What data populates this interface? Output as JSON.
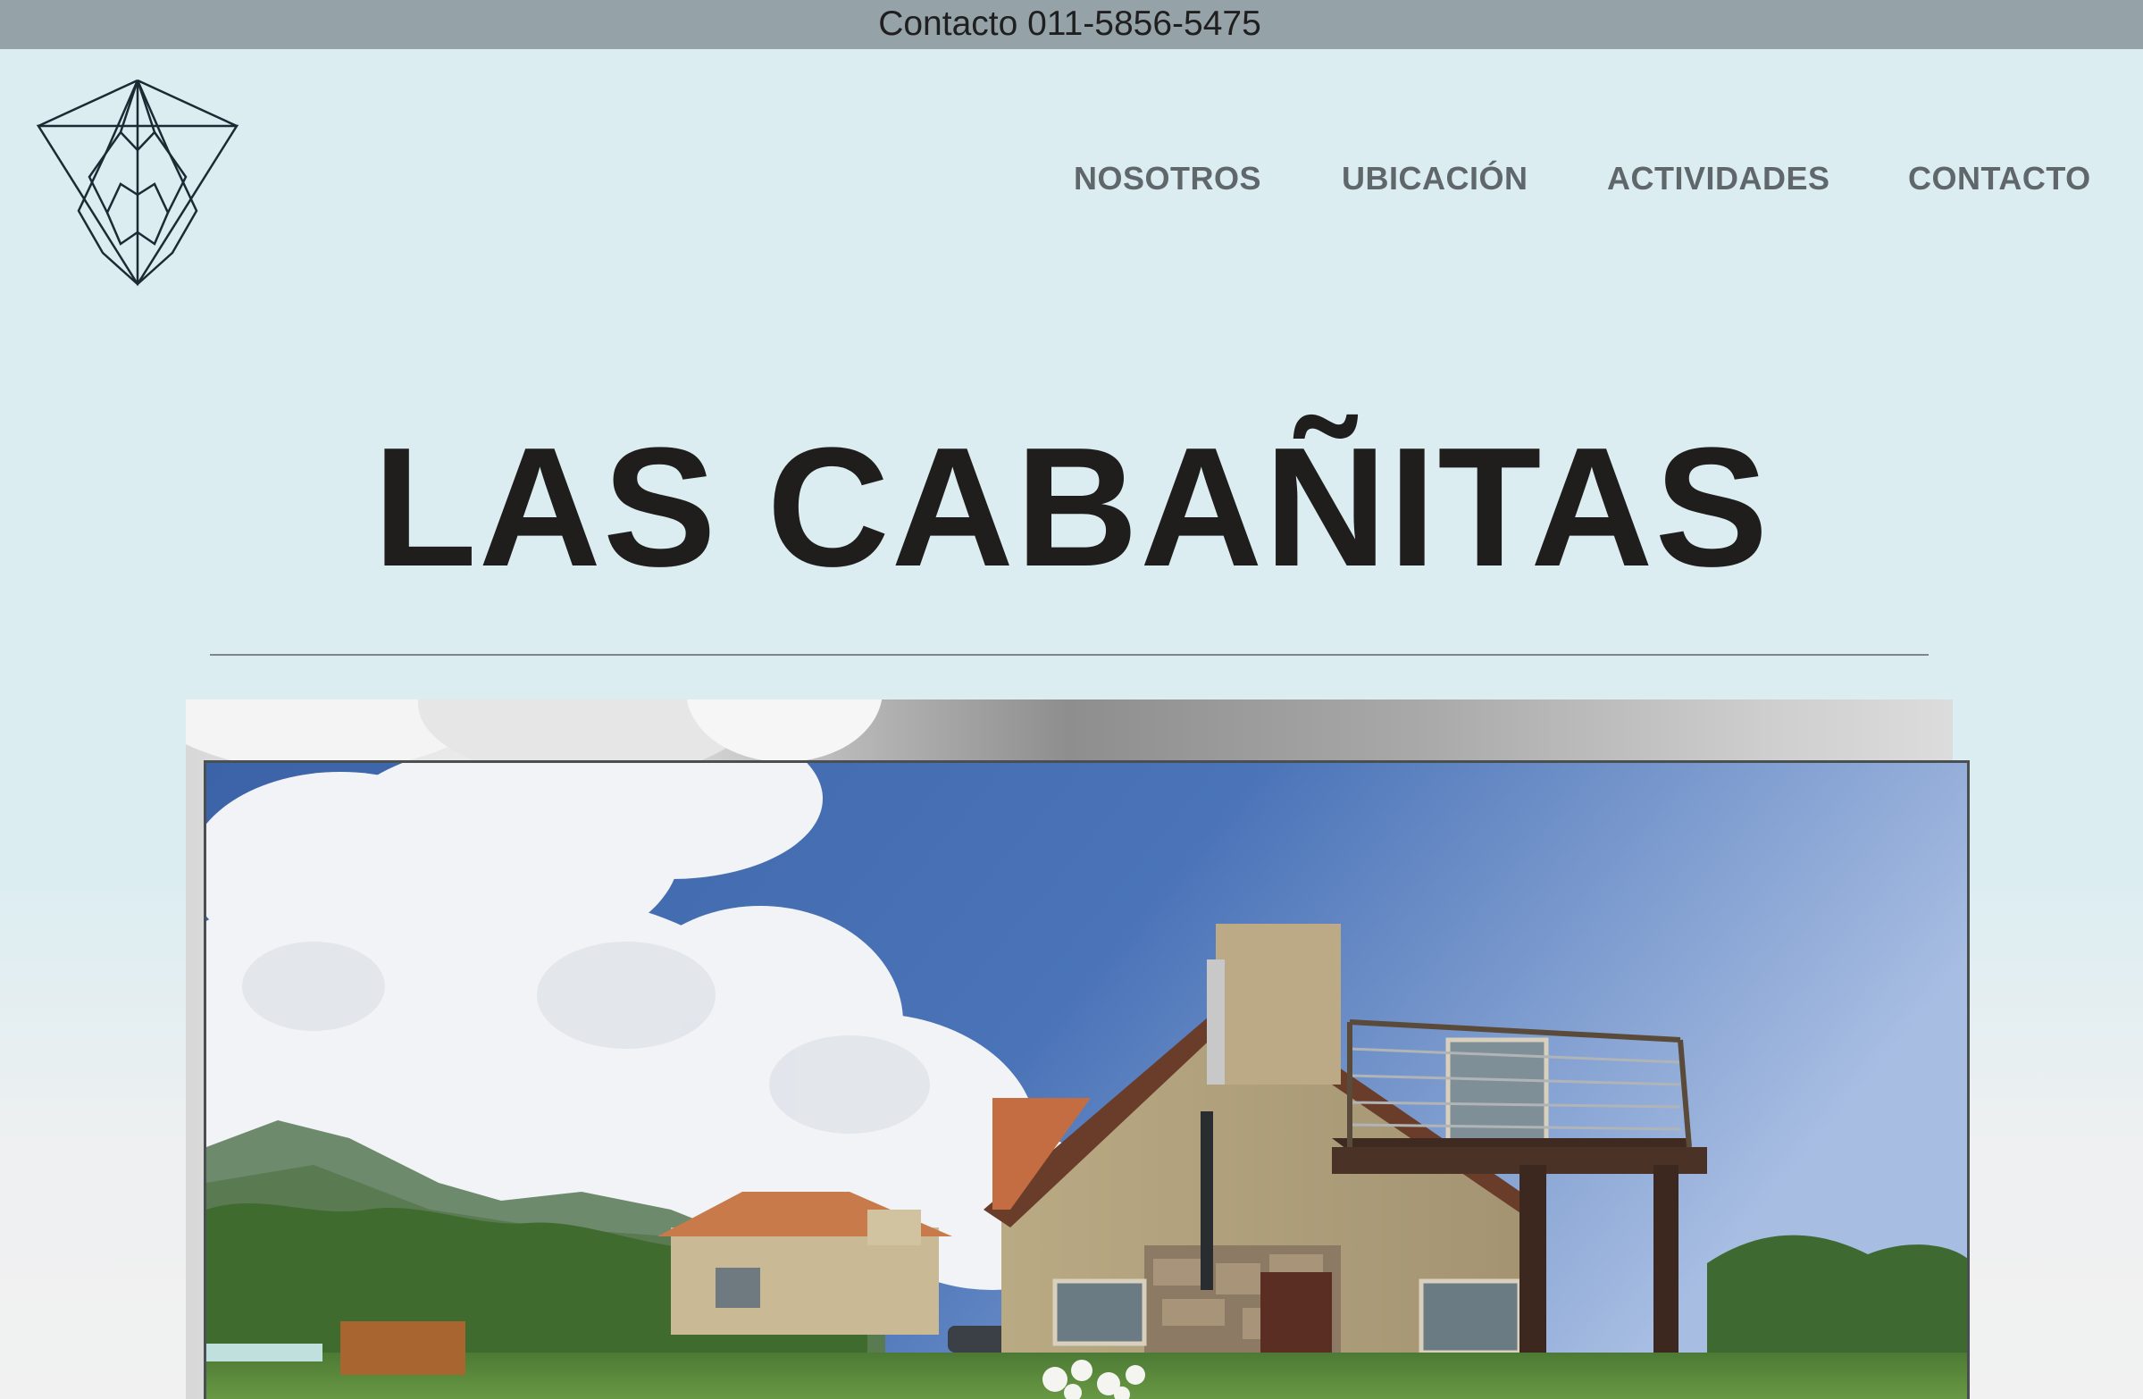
{
  "topbar": {
    "text": "Contacto 011-5856-5475"
  },
  "nav": {
    "items": [
      {
        "label": "NOSOTROS"
      },
      {
        "label": "UBICACIÓN"
      },
      {
        "label": "ACTIVIDADES"
      },
      {
        "label": "CONTACTO"
      }
    ]
  },
  "hero": {
    "title": "LAS CABAÑITAS"
  },
  "logo": {
    "icon": "geometric-mountain-triangle-logo"
  },
  "colors": {
    "page_bg": "#dbedf1",
    "topbar_bg": "#95a3a9",
    "nav_text": "#5f676b",
    "title_text": "#1f1e1c"
  }
}
